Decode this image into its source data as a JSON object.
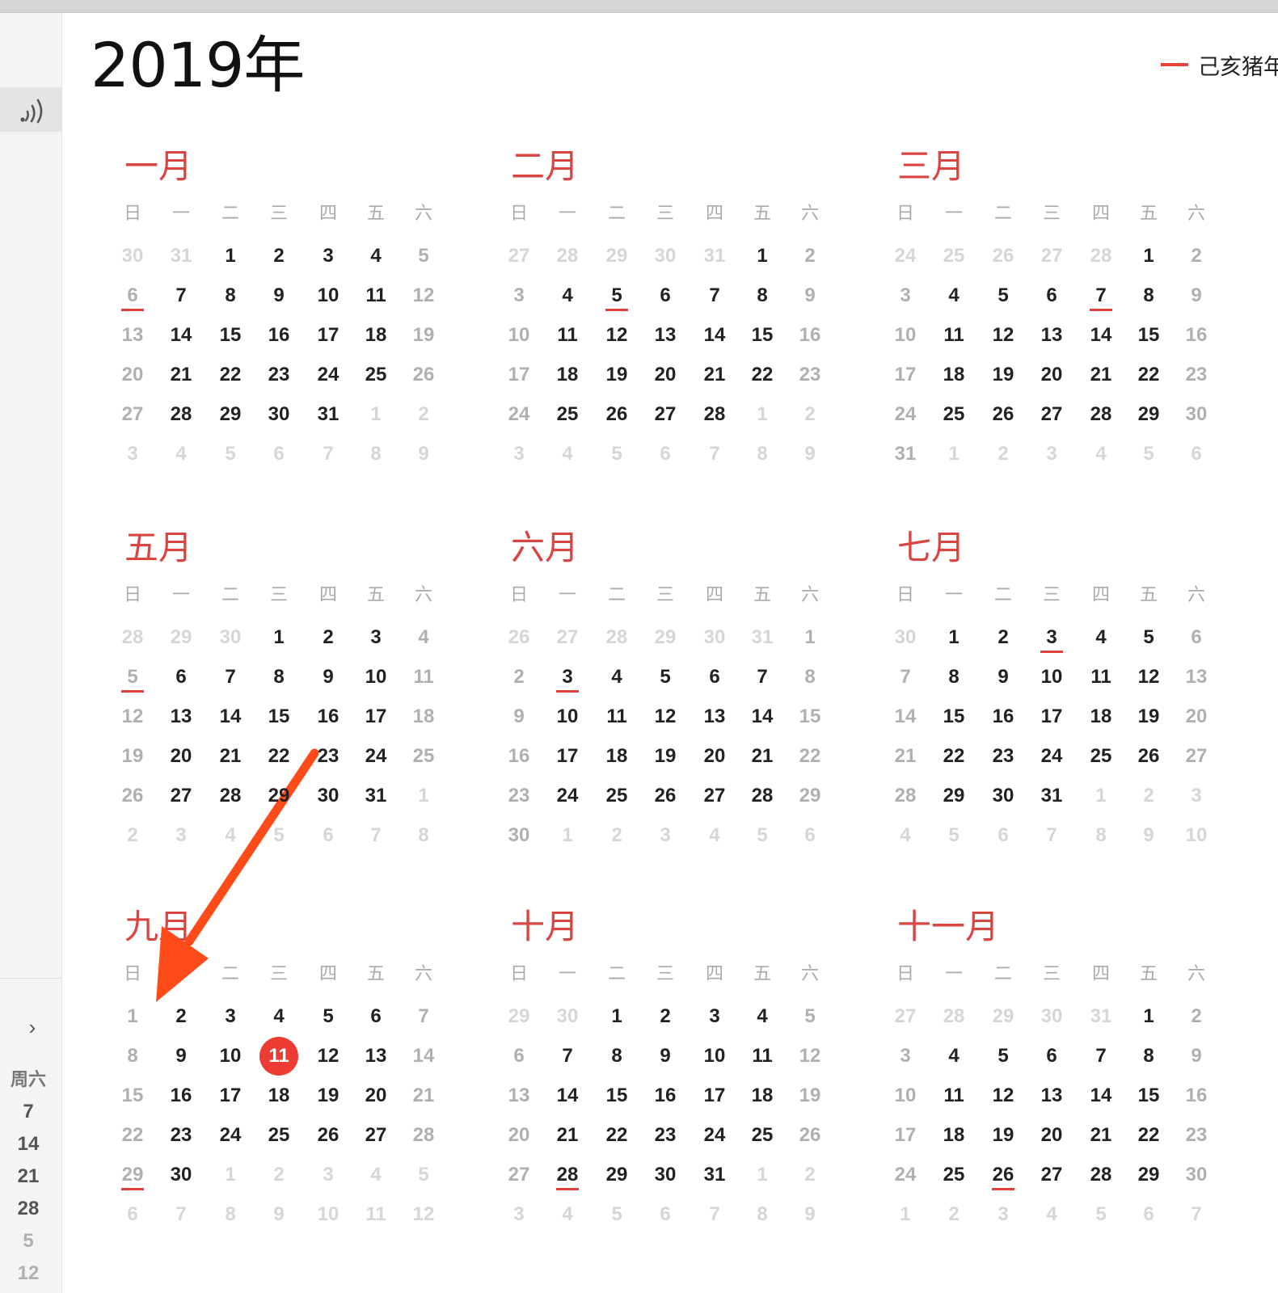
{
  "header": {
    "year_title": "2019年",
    "ganzhi": "己亥猪年"
  },
  "weekdays": [
    "日",
    "一",
    "二",
    "三",
    "四",
    "五",
    "六"
  ],
  "sidebar": {
    "weekday_label": "周六",
    "numbers": [
      "7",
      "14",
      "21",
      "28",
      "5",
      "12"
    ]
  },
  "colors": {
    "accent": "#e8403a",
    "today_bg": "#ee3b33",
    "month_title": "#d94540"
  },
  "today": {
    "month": 9,
    "day": 11
  },
  "months": [
    {
      "title": "一月",
      "month": 1,
      "weeks": [
        [
          "30",
          "31",
          "1",
          "2",
          "3",
          "4",
          "5"
        ],
        [
          "6",
          "7",
          "8",
          "9",
          "10",
          "11",
          "12"
        ],
        [
          "13",
          "14",
          "15",
          "16",
          "17",
          "18",
          "19"
        ],
        [
          "20",
          "21",
          "22",
          "23",
          "24",
          "25",
          "26"
        ],
        [
          "27",
          "28",
          "29",
          "30",
          "31",
          "1",
          "2"
        ],
        [
          "3",
          "4",
          "5",
          "6",
          "7",
          "8",
          "9"
        ]
      ],
      "holidays": [
        6
      ]
    },
    {
      "title": "二月",
      "month": 2,
      "weeks": [
        [
          "27",
          "28",
          "29",
          "30",
          "31",
          "1",
          "2"
        ],
        [
          "3",
          "4",
          "5",
          "6",
          "7",
          "8",
          "9"
        ],
        [
          "10",
          "11",
          "12",
          "13",
          "14",
          "15",
          "16"
        ],
        [
          "17",
          "18",
          "19",
          "20",
          "21",
          "22",
          "23"
        ],
        [
          "24",
          "25",
          "26",
          "27",
          "28",
          "1",
          "2"
        ],
        [
          "3",
          "4",
          "5",
          "6",
          "7",
          "8",
          "9"
        ]
      ],
      "holidays": [
        5
      ]
    },
    {
      "title": "三月",
      "month": 3,
      "weeks": [
        [
          "24",
          "25",
          "26",
          "27",
          "28",
          "1",
          "2"
        ],
        [
          "3",
          "4",
          "5",
          "6",
          "7",
          "8",
          "9"
        ],
        [
          "10",
          "11",
          "12",
          "13",
          "14",
          "15",
          "16"
        ],
        [
          "17",
          "18",
          "19",
          "20",
          "21",
          "22",
          "23"
        ],
        [
          "24",
          "25",
          "26",
          "27",
          "28",
          "29",
          "30"
        ],
        [
          "31",
          "1",
          "2",
          "3",
          "4",
          "5",
          "6"
        ]
      ],
      "holidays": [
        7
      ]
    },
    {
      "title": "五月",
      "month": 5,
      "weeks": [
        [
          "28",
          "29",
          "30",
          "1",
          "2",
          "3",
          "4"
        ],
        [
          "5",
          "6",
          "7",
          "8",
          "9",
          "10",
          "11"
        ],
        [
          "12",
          "13",
          "14",
          "15",
          "16",
          "17",
          "18"
        ],
        [
          "19",
          "20",
          "21",
          "22",
          "23",
          "24",
          "25"
        ],
        [
          "26",
          "27",
          "28",
          "29",
          "30",
          "31",
          "1"
        ],
        [
          "2",
          "3",
          "4",
          "5",
          "6",
          "7",
          "8"
        ]
      ],
      "holidays": [
        5
      ]
    },
    {
      "title": "六月",
      "month": 6,
      "weeks": [
        [
          "26",
          "27",
          "28",
          "29",
          "30",
          "31",
          "1"
        ],
        [
          "2",
          "3",
          "4",
          "5",
          "6",
          "7",
          "8"
        ],
        [
          "9",
          "10",
          "11",
          "12",
          "13",
          "14",
          "15"
        ],
        [
          "16",
          "17",
          "18",
          "19",
          "20",
          "21",
          "22"
        ],
        [
          "23",
          "24",
          "25",
          "26",
          "27",
          "28",
          "29"
        ],
        [
          "30",
          "1",
          "2",
          "3",
          "4",
          "5",
          "6"
        ]
      ],
      "holidays": [
        3
      ]
    },
    {
      "title": "七月",
      "month": 7,
      "weeks": [
        [
          "30",
          "1",
          "2",
          "3",
          "4",
          "5",
          "6"
        ],
        [
          "7",
          "8",
          "9",
          "10",
          "11",
          "12",
          "13"
        ],
        [
          "14",
          "15",
          "16",
          "17",
          "18",
          "19",
          "20"
        ],
        [
          "21",
          "22",
          "23",
          "24",
          "25",
          "26",
          "27"
        ],
        [
          "28",
          "29",
          "30",
          "31",
          "1",
          "2",
          "3"
        ],
        [
          "4",
          "5",
          "6",
          "7",
          "8",
          "9",
          "10"
        ]
      ],
      "holidays": [
        3
      ]
    },
    {
      "title": "九月",
      "month": 9,
      "weeks": [
        [
          "1",
          "2",
          "3",
          "4",
          "5",
          "6",
          "7"
        ],
        [
          "8",
          "9",
          "10",
          "11",
          "12",
          "13",
          "14"
        ],
        [
          "15",
          "16",
          "17",
          "18",
          "19",
          "20",
          "21"
        ],
        [
          "22",
          "23",
          "24",
          "25",
          "26",
          "27",
          "28"
        ],
        [
          "29",
          "30",
          "1",
          "2",
          "3",
          "4",
          "5"
        ],
        [
          "6",
          "7",
          "8",
          "9",
          "10",
          "11",
          "12"
        ]
      ],
      "holidays": [
        29
      ]
    },
    {
      "title": "十月",
      "month": 10,
      "weeks": [
        [
          "29",
          "30",
          "1",
          "2",
          "3",
          "4",
          "5"
        ],
        [
          "6",
          "7",
          "8",
          "9",
          "10",
          "11",
          "12"
        ],
        [
          "13",
          "14",
          "15",
          "16",
          "17",
          "18",
          "19"
        ],
        [
          "20",
          "21",
          "22",
          "23",
          "24",
          "25",
          "26"
        ],
        [
          "27",
          "28",
          "29",
          "30",
          "31",
          "1",
          "2"
        ],
        [
          "3",
          "4",
          "5",
          "6",
          "7",
          "8",
          "9"
        ]
      ],
      "holidays": [
        28
      ]
    },
    {
      "title": "十一月",
      "month": 11,
      "weeks": [
        [
          "27",
          "28",
          "29",
          "30",
          "31",
          "1",
          "2"
        ],
        [
          "3",
          "4",
          "5",
          "6",
          "7",
          "8",
          "9"
        ],
        [
          "10",
          "11",
          "12",
          "13",
          "14",
          "15",
          "16"
        ],
        [
          "17",
          "18",
          "19",
          "20",
          "21",
          "22",
          "23"
        ],
        [
          "24",
          "25",
          "26",
          "27",
          "28",
          "29",
          "30"
        ],
        [
          "1",
          "2",
          "3",
          "4",
          "5",
          "6",
          "7"
        ]
      ],
      "holidays": [
        26
      ]
    }
  ]
}
